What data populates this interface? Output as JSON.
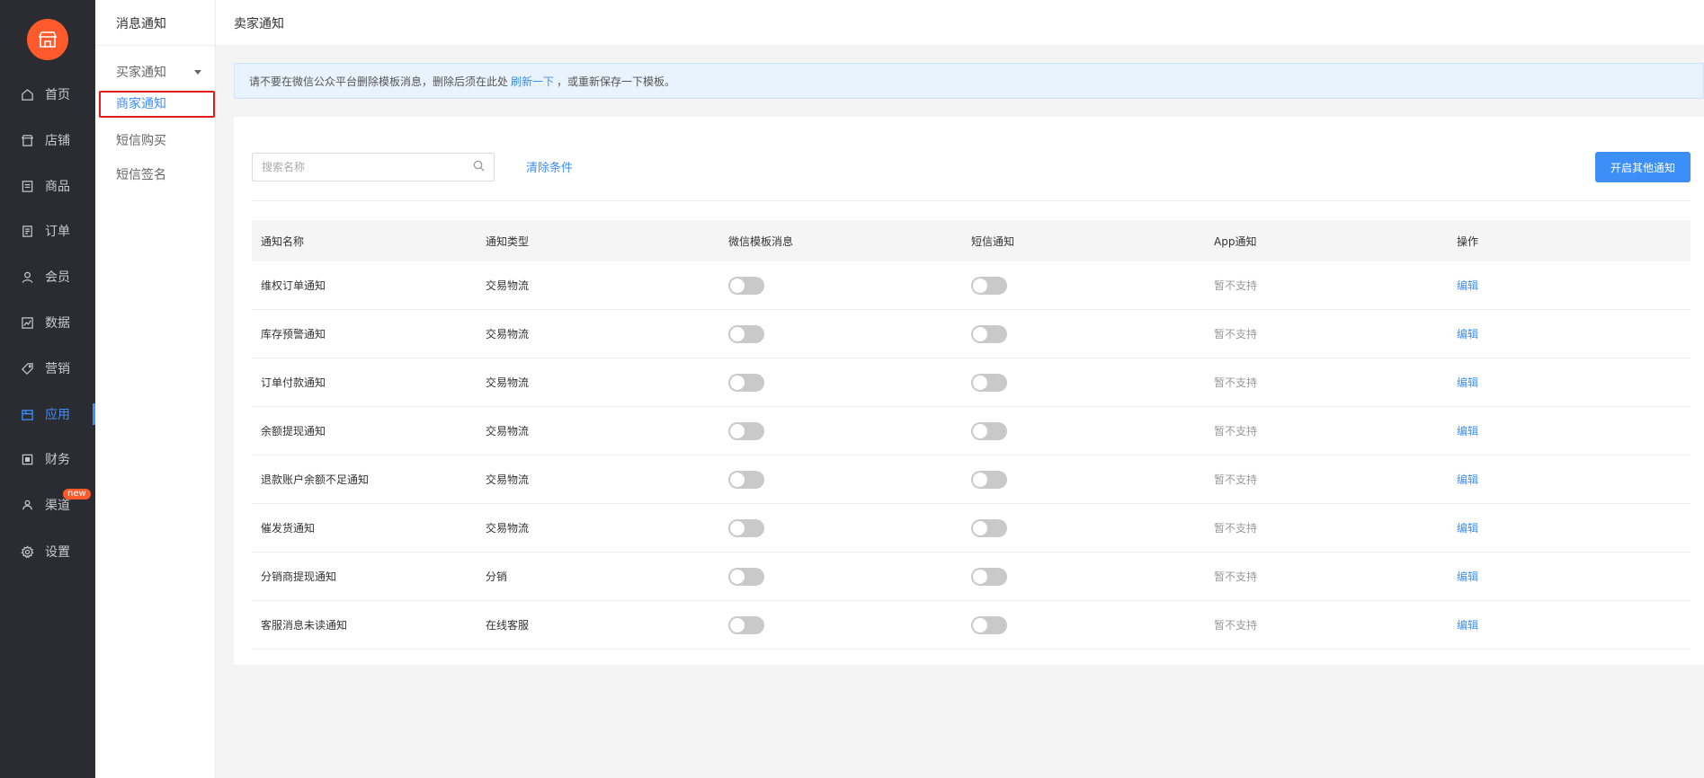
{
  "nav": {
    "logo_icon": "store-icon",
    "items": [
      {
        "label": "首页",
        "icon": "home-icon"
      },
      {
        "label": "店铺",
        "icon": "shop-icon"
      },
      {
        "label": "商品",
        "icon": "goods-icon"
      },
      {
        "label": "订单",
        "icon": "order-icon"
      },
      {
        "label": "会员",
        "icon": "user-icon"
      },
      {
        "label": "数据",
        "icon": "chart-icon"
      },
      {
        "label": "营销",
        "icon": "tag-icon"
      },
      {
        "label": "应用",
        "icon": "app-icon",
        "active": true
      },
      {
        "label": "财务",
        "icon": "finance-icon"
      },
      {
        "label": "渠道",
        "icon": "channel-icon",
        "badge": "new"
      },
      {
        "label": "设置",
        "icon": "gear-icon"
      }
    ]
  },
  "submenu": {
    "title": "消息通知",
    "items": [
      {
        "label": "买家通知",
        "group": true
      },
      {
        "label": "商家通知",
        "active": true
      },
      {
        "label": "短信购买"
      },
      {
        "label": "短信签名"
      }
    ]
  },
  "page": {
    "title": "卖家通知",
    "notice_before": "请不要在微信公众平台删除模板消息，删除后须在此处",
    "notice_link": "刷新一下",
    "notice_after": "，或重新保存一下模板。"
  },
  "toolbar": {
    "search_placeholder": "搜索名称",
    "clear_label": "清除条件",
    "primary_label": "开启其他通知"
  },
  "table": {
    "headers": [
      "通知名称",
      "通知类型",
      "微信模板消息",
      "短信通知",
      "App通知",
      "操作"
    ],
    "rows": [
      {
        "name": "维权订单通知",
        "type": "交易物流",
        "app": "暂不支持",
        "action": "编辑"
      },
      {
        "name": "库存预警通知",
        "type": "交易物流",
        "app": "暂不支持",
        "action": "编辑"
      },
      {
        "name": "订单付款通知",
        "type": "交易物流",
        "app": "暂不支持",
        "action": "编辑"
      },
      {
        "name": "余额提现通知",
        "type": "交易物流",
        "app": "暂不支持",
        "action": "编辑"
      },
      {
        "name": "退款账户余额不足通知",
        "type": "交易物流",
        "app": "暂不支持",
        "action": "编辑"
      },
      {
        "name": "催发货通知",
        "type": "交易物流",
        "app": "暂不支持",
        "action": "编辑"
      },
      {
        "name": "分销商提现通知",
        "type": "分销",
        "app": "暂不支持",
        "action": "编辑"
      },
      {
        "name": "客服消息未读通知",
        "type": "在线客服",
        "app": "暂不支持",
        "action": "编辑"
      }
    ]
  },
  "colors": {
    "accent": "#3e8ef7",
    "brand": "#ff5a2c",
    "nav_bg": "#2b2c31",
    "highlight": "#e21a1a"
  }
}
